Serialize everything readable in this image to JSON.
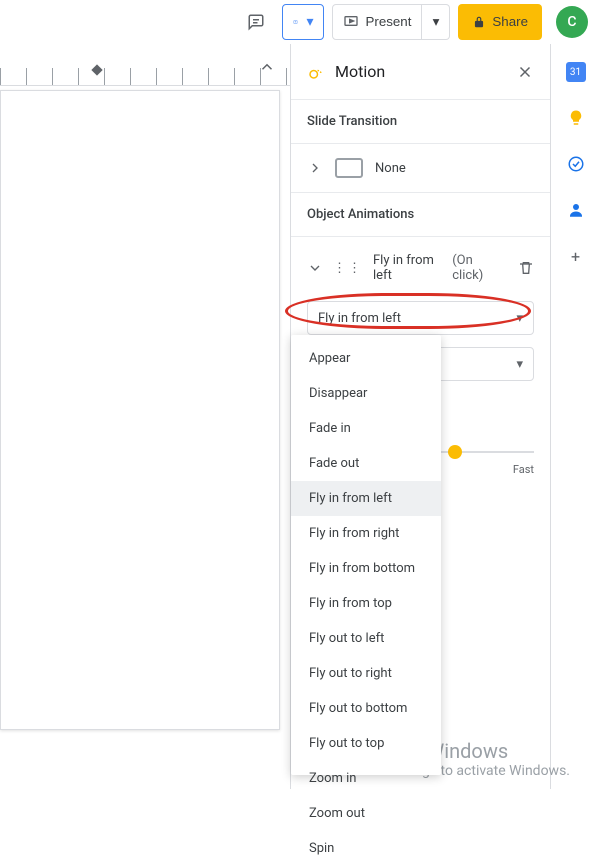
{
  "toolbar": {
    "present_label": "Present",
    "share_label": "Share",
    "avatar_initial": "C"
  },
  "motion": {
    "title": "Motion",
    "slide_transition_label": "Slide Transition",
    "transition_value": "None",
    "object_animations_label": "Object Animations",
    "current_animation": {
      "effect": "Fly in from left",
      "trigger": "(On click)"
    },
    "effect_select_value": "Fly in from left",
    "speed_label_fast": "Fast",
    "animation_options": [
      "Appear",
      "Disappear",
      "Fade in",
      "Fade out",
      "Fly in from left",
      "Fly in from right",
      "Fly in from bottom",
      "Fly in from top",
      "Fly out to left",
      "Fly out to right",
      "Fly out to bottom",
      "Fly out to top",
      "Zoom in",
      "Zoom out",
      "Spin"
    ]
  },
  "side": {
    "calendar_day": "31"
  },
  "watermark": {
    "line1": "Activate Windows",
    "line2": "Go to Settings to activate Windows."
  }
}
